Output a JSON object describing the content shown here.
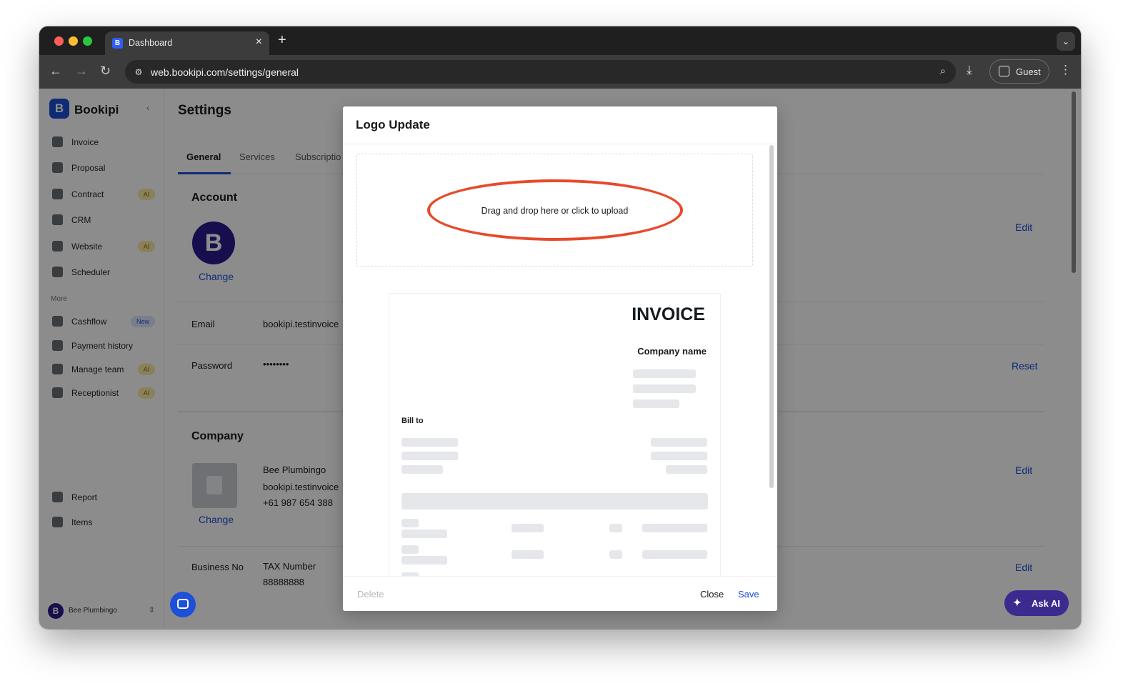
{
  "browser": {
    "tab_title": "Dashboard",
    "url": "web.bookipi.com/settings/general",
    "guest_label": "Guest"
  },
  "sidebar": {
    "brand": "Bookipi",
    "items": [
      {
        "label": "Invoice",
        "badge": ""
      },
      {
        "label": "Proposal",
        "badge": ""
      },
      {
        "label": "Contract",
        "badge": "AI"
      },
      {
        "label": "CRM",
        "badge": ""
      },
      {
        "label": "Website",
        "badge": "AI"
      },
      {
        "label": "Scheduler",
        "badge": ""
      }
    ],
    "more_label": "More",
    "more_items": [
      {
        "label": "Cashflow",
        "badge": "New"
      },
      {
        "label": "Payment history",
        "badge": ""
      },
      {
        "label": "Manage team",
        "badge": "AI"
      },
      {
        "label": "Receptionist",
        "badge": "AI"
      }
    ],
    "bottom_items": [
      {
        "label": "Report"
      },
      {
        "label": "Items"
      }
    ],
    "user_name": "Bee Plumbingo"
  },
  "settings": {
    "title": "Settings",
    "tabs": [
      "General",
      "Services",
      "Subscriptio"
    ],
    "account": {
      "title": "Account",
      "change_label": "Change",
      "edit_label": "Edit",
      "email_label": "Email",
      "email_value": "bookipi.testinvoice",
      "password_label": "Password",
      "password_value": "••••••••",
      "reset_label": "Reset"
    },
    "company": {
      "title": "Company",
      "change_label": "Change",
      "edit_label": "Edit",
      "name": "Bee Plumbingo",
      "email": "bookipi.testinvoice",
      "phone": "+61 987 654 388",
      "business_no_label": "Business No",
      "tax_label": "TAX Number",
      "tax_value": "88888888",
      "business_edit_label": "Edit"
    }
  },
  "modal": {
    "title": "Logo Update",
    "dropzone_text": "Drag and drop here or click to upload",
    "invoice_title": "INVOICE",
    "company_name": "Company name",
    "bill_to": "Bill to",
    "delete_label": "Delete",
    "close_label": "Close",
    "save_label": "Save"
  },
  "ask_ai_label": "Ask AI",
  "colors": {
    "accent": "#1d4fd8",
    "highlight": "#e8492b",
    "brand_dark": "#2a1c8c"
  }
}
